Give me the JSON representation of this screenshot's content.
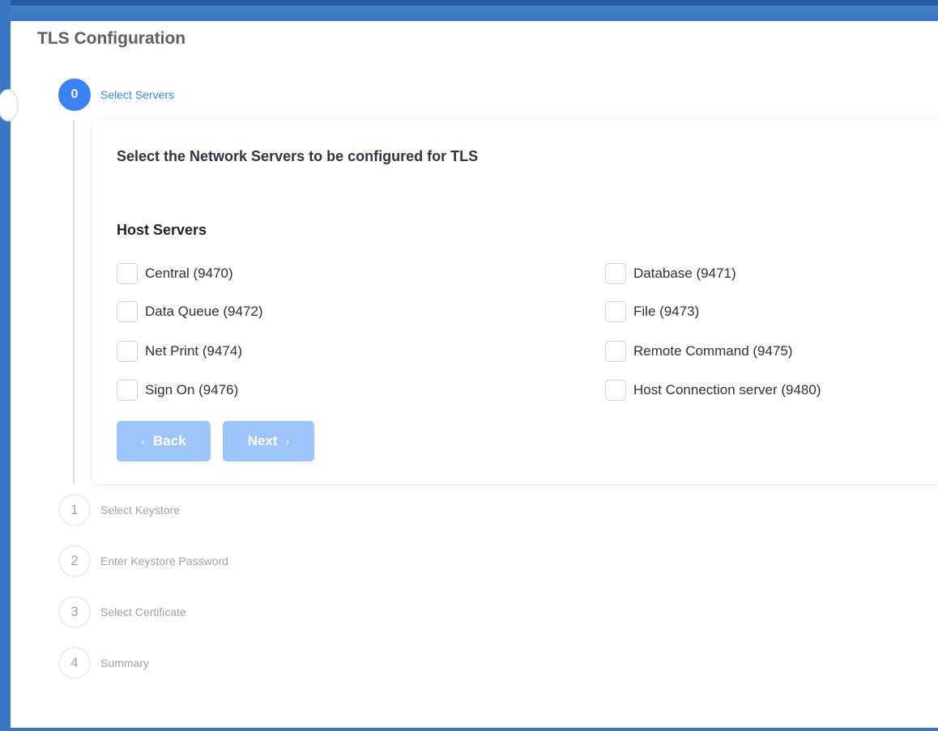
{
  "page": {
    "title": "TLS Configuration"
  },
  "steps": [
    {
      "number": "0",
      "label": "Select Servers",
      "active": true
    },
    {
      "number": "1",
      "label": "Select Keystore",
      "active": false
    },
    {
      "number": "2",
      "label": "Enter Keystore Password",
      "active": false
    },
    {
      "number": "3",
      "label": "Select Certificate",
      "active": false
    },
    {
      "number": "4",
      "label": "Summary",
      "active": false
    }
  ],
  "card": {
    "heading": "Select the Network Servers to be configured for TLS",
    "section_title": "Host Servers",
    "options": [
      {
        "label": "Central (9470)",
        "checked": false
      },
      {
        "label": "Database (9471)",
        "checked": false
      },
      {
        "label": "Data Queue (9472)",
        "checked": false
      },
      {
        "label": "File (9473)",
        "checked": false
      },
      {
        "label": "Net Print (9474)",
        "checked": false
      },
      {
        "label": "Remote Command (9475)",
        "checked": false
      },
      {
        "label": "Sign On (9476)",
        "checked": false
      },
      {
        "label": "Host Connection server (9480)",
        "checked": false
      }
    ],
    "buttons": {
      "back_label": "Back",
      "back_icon": "chevron-left-icon",
      "next_label": "Next",
      "next_icon": "chevron-right-icon"
    }
  },
  "colors": {
    "accent": "#3b82f6",
    "button_disabled": "#9ec5fa",
    "frame": "#3c77c4"
  }
}
